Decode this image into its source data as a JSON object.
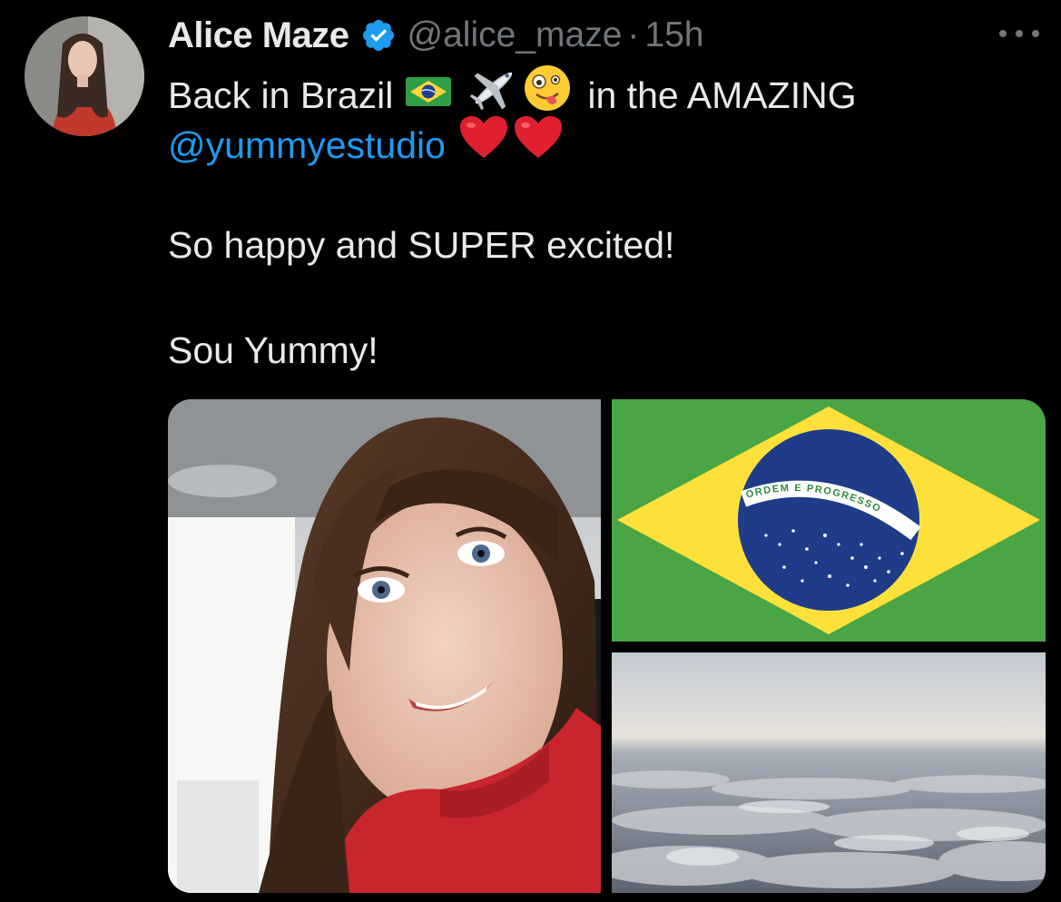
{
  "tweet": {
    "author_name": "Alice Maze",
    "handle": "@alice_maze",
    "separator": "·",
    "time": "15h",
    "text_line1_a": "Back in Brazil",
    "text_line1_b": "in the AMAZING",
    "mention": "@yummyestudio",
    "text_line3": "So happy and SUPER excited!",
    "text_line4": "Sou Yummy!",
    "flag_motto": "ORDEM E PROGRESSO"
  },
  "icons": {
    "verified": "verified-badge-icon",
    "more": "more-options-icon",
    "brazil_flag_emoji": "brazil-flag-emoji",
    "airplane_emoji": "airplane-emoji",
    "zany_face_emoji": "zany-face-emoji",
    "heart_emoji": "red-heart-emoji"
  },
  "colors": {
    "background": "#000000",
    "text": "#e7e9ea",
    "secondary": "#71767b",
    "link": "#1d9bf0",
    "verified": "#1d9bf0"
  }
}
